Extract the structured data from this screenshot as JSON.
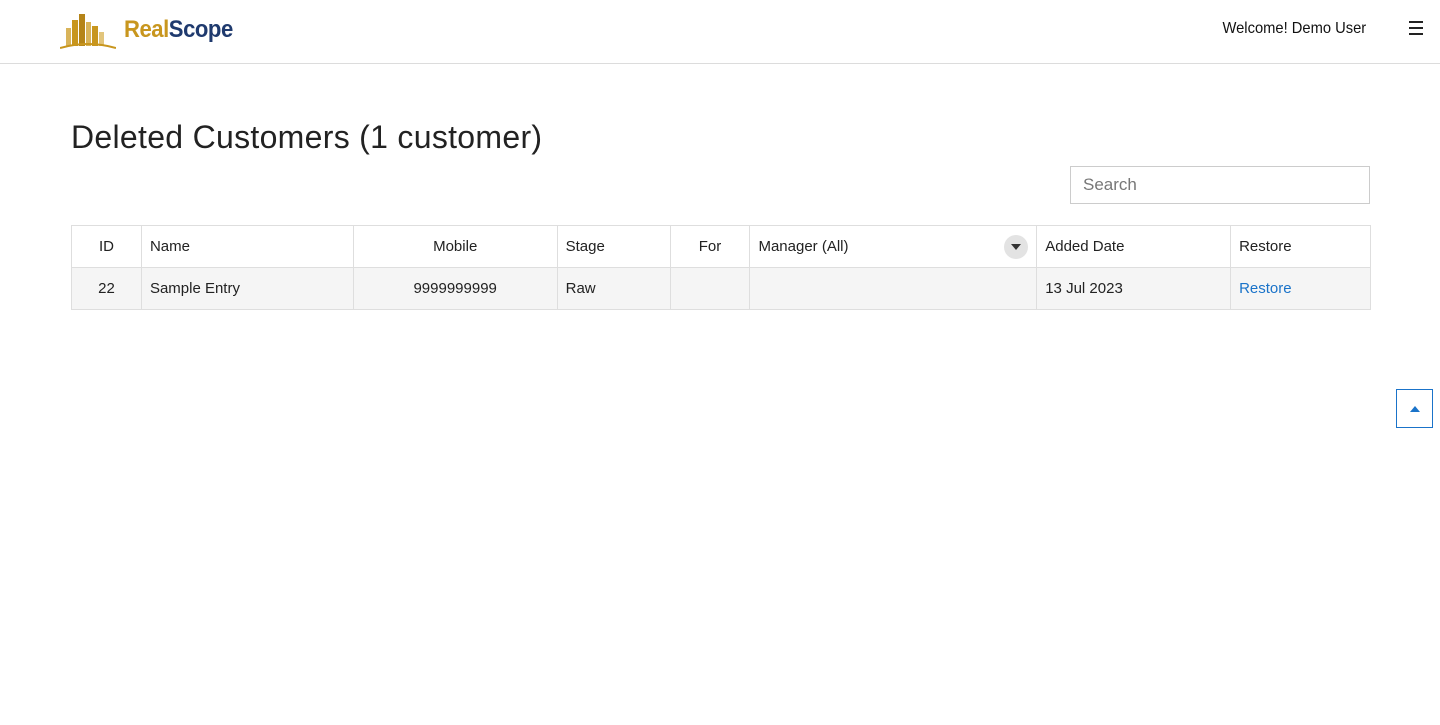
{
  "header": {
    "brand_part1": "Real",
    "brand_part2": "Scope",
    "welcome_text": "Welcome! Demo User",
    "menu_icon": "hamburger-menu-icon"
  },
  "page": {
    "title": "Deleted Customers (1 customer)"
  },
  "search": {
    "placeholder": "Search",
    "value": ""
  },
  "table": {
    "columns": [
      "ID",
      "Name",
      "Mobile",
      "Stage",
      "For",
      "Manager (All)",
      "Added Date",
      "Restore"
    ],
    "rows": [
      {
        "id": "22",
        "name": "Sample Entry",
        "mobile": "9999999999",
        "stage": "Raw",
        "for": "",
        "manager": "",
        "added_date": "13 Jul 2023",
        "restore": "Restore"
      }
    ]
  },
  "colors": {
    "brand_gold": "#c8961e",
    "brand_navy": "#1f3a6e",
    "link_blue": "#1a73c9"
  },
  "scroll_top_icon": "chevron-up-icon"
}
